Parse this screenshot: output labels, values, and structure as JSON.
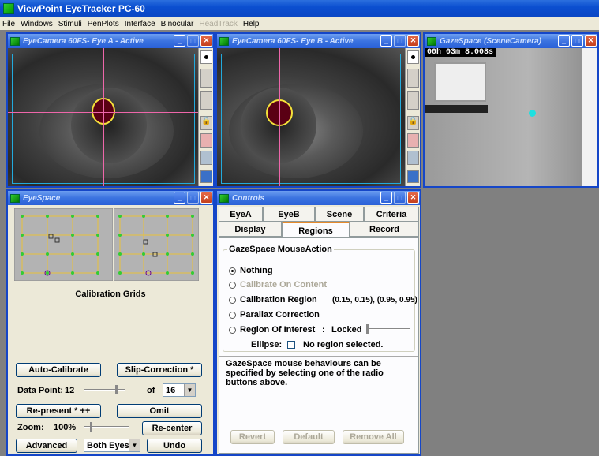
{
  "app": {
    "title": "ViewPoint EyeTracker PC-60"
  },
  "menu": [
    "File",
    "Windows",
    "Stimuli",
    "PenPlots",
    "Interface",
    "Binocular",
    "HeadTrack",
    "Help"
  ],
  "eye_a": {
    "title": "EyeCamera 60FS- Eye A - Active"
  },
  "eye_b": {
    "title": "EyeCamera 60FS- Eye B - Active"
  },
  "gaze": {
    "title": "GazeSpace (SceneCamera)",
    "timer": "00h 03m 8.008s"
  },
  "eyespace": {
    "title": "EyeSpace",
    "grids_label": "Calibration Grids",
    "auto_calibrate": "Auto-Calibrate",
    "slip_correction": "Slip-Correction *",
    "data_point_label": "Data Point:",
    "data_point_value": "12",
    "of_label": "of",
    "of_value": "16",
    "represent": "Re-present * ++",
    "omit": "Omit",
    "zoom_label": "Zoom:",
    "zoom_value": "100%",
    "recenter": "Re-center",
    "advanced": "Advanced",
    "eyes_select": "Both Eyes",
    "undo": "Undo"
  },
  "controls": {
    "title": "Controls",
    "tabs_row1": [
      "EyeA",
      "EyeB",
      "Scene",
      "Criteria"
    ],
    "tabs_row2": [
      "Display",
      "Regions",
      "Record"
    ],
    "group_title": "GazeSpace MouseAction",
    "opt_nothing": "Nothing",
    "opt_calib_content": "Calibrate On Content",
    "opt_calib_region": "Calibration Region",
    "calib_region_value": "(0.15, 0.15), (0.95, 0.95)",
    "opt_parallax": "Parallax Correction",
    "opt_roi": "Region Of Interest",
    "roi_sep": ":",
    "roi_state": "Locked",
    "ellipse_label": "Ellipse:",
    "region_status": "No region selected.",
    "help_text": "GazeSpace mouse behaviours can be specified by selecting one of the radio buttons above.",
    "revert": "Revert",
    "default": "Default",
    "remove_all": "Remove All"
  }
}
